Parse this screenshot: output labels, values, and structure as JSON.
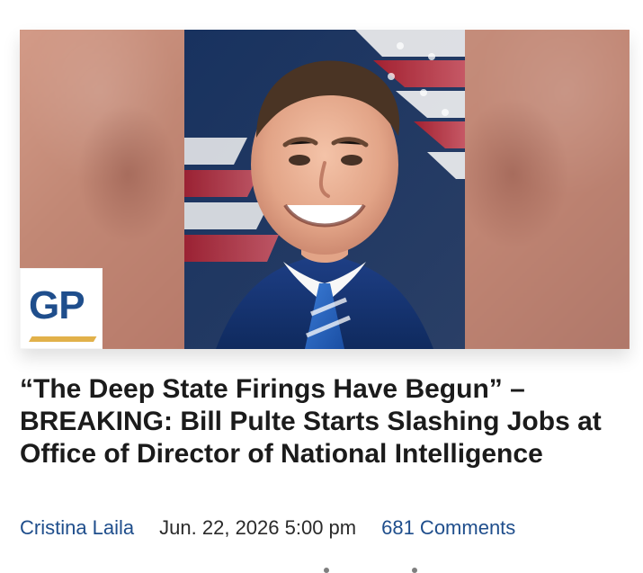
{
  "article": {
    "logo_text": "GP",
    "headline": "“The Deep State Firings Have Begun” – BREAKING: Bill Pulte Starts Slashing Jobs at Office of Director of National Intelligence",
    "author": "Cristina Laila",
    "date": "Jun. 22, 2026 5:00 pm",
    "comments": "681 Comments"
  },
  "colors": {
    "link_blue": "#1f4e8c",
    "logo_blue": "#1f4e8c",
    "logo_gold": "#e2b14a",
    "text_dark": "#1b1b1b"
  }
}
